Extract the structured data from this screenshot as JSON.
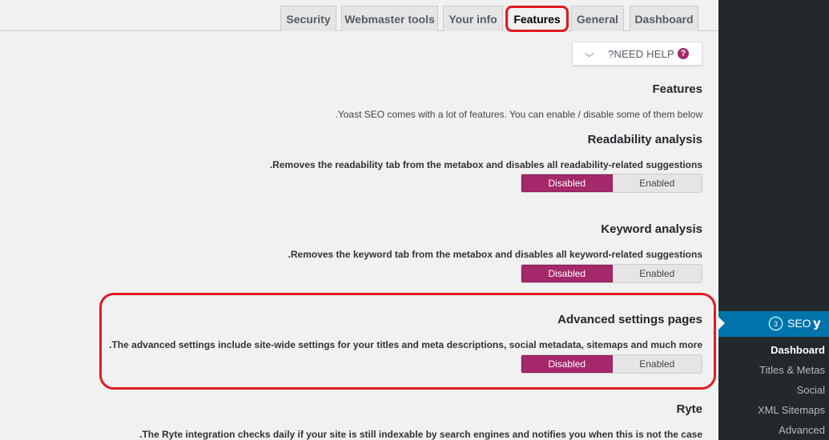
{
  "tabs": [
    {
      "label": "Security",
      "active": false
    },
    {
      "label": "Webmaster tools",
      "active": false
    },
    {
      "label": "Your info",
      "active": false
    },
    {
      "label": "Features",
      "active": true
    },
    {
      "label": "General",
      "active": false
    },
    {
      "label": "Dashboard",
      "active": false
    }
  ],
  "help": {
    "label": "?NEED HELP",
    "chevron_icon": "chevron-down-icon",
    "question_icon": "question-icon",
    "glyph": "?"
  },
  "page": {
    "title": "Features",
    "intro": ".Yoast SEO comes with a lot of features. You can enable / disable some of them below"
  },
  "features": [
    {
      "title": "Readability analysis",
      "description": ".Removes the readability tab from the metabox and disables all readability-related suggestions",
      "options": [
        "Disabled",
        "Enabled"
      ],
      "selected": "Disabled"
    },
    {
      "title": "Keyword analysis",
      "description": ".Removes the keyword tab from the metabox and disables all keyword-related suggestions",
      "options": [
        "Disabled",
        "Enabled"
      ],
      "selected": "Disabled"
    },
    {
      "title": "Advanced settings pages",
      "description": ".The advanced settings include site-wide settings for your titles and meta descriptions, social metadata, sitemaps and much more",
      "options": [
        "Disabled",
        "Enabled"
      ],
      "selected": "Disabled"
    },
    {
      "title": "Ryte",
      "description": ".The Ryte integration checks daily if your site is still indexable by search engines and notifies you when this is not the case"
    }
  ],
  "sidebar": {
    "seo": {
      "label": "SEO",
      "badge": "3",
      "logo_glyph": "y"
    },
    "items": [
      "Dashboard",
      "Titles & Metas",
      "Social",
      "XML Sitemaps",
      "Advanced"
    ],
    "current": "Dashboard"
  },
  "colors": {
    "accent": "#a4286a",
    "highlight": "#e11b22",
    "admin_blue": "#0073aa",
    "sidebar_bg": "#23282d"
  }
}
